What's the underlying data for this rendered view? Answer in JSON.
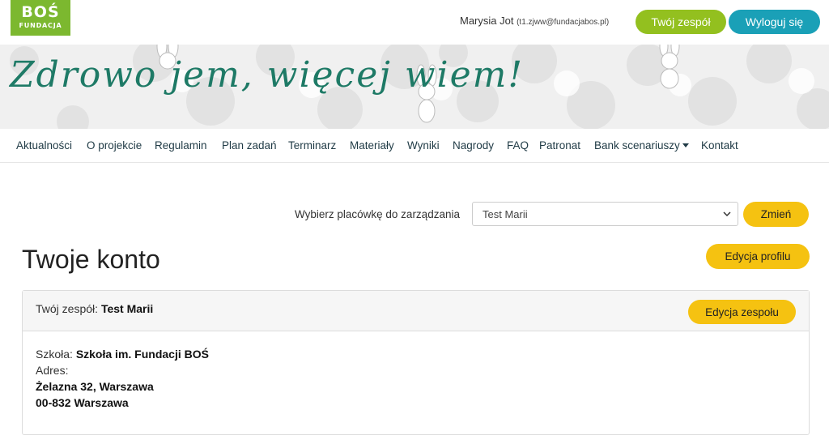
{
  "brand": {
    "name_top": "BOŚ",
    "name_bottom": "FUNDACJA"
  },
  "user": {
    "name": "Marysia Jot",
    "email": "(t1.zjww@fundacjabos.pl)"
  },
  "header_buttons": {
    "team": "Twój zespół",
    "logout": "Wyloguj się"
  },
  "banner": {
    "title": "Zdrowo jem, więcej wiem!"
  },
  "nav": {
    "items": [
      "Aktualności",
      "O projekcie",
      "Regulamin",
      "Plan zadań",
      "Terminarz",
      "Materiały",
      "Wyniki",
      "Nagrody",
      "FAQ",
      "Patronat",
      "Bank scenariuszy",
      "Kontakt"
    ]
  },
  "facility": {
    "label": "Wybierz placówkę do zarządzania",
    "selected": "Test Marii",
    "button": "Zmień"
  },
  "account": {
    "title": "Twoje konto",
    "edit_profile": "Edycja profilu"
  },
  "team_card": {
    "team_label": "Twój zespół:",
    "team_name": "Test Marii",
    "edit_team": "Edycja zespołu",
    "school_label": "Szkoła:",
    "school_name": "Szkoła im. Fundacji BOŚ",
    "address_label": "Adres:",
    "address_line1": "Żelazna 32, Warszawa",
    "address_line2": "00-832 Warszawa"
  },
  "colors": {
    "brand_green": "#7cb82f",
    "team_button": "#93c01f",
    "logout_button": "#1aa0b7",
    "accent_yellow": "#f5c211",
    "banner_text": "#1e7a66"
  }
}
